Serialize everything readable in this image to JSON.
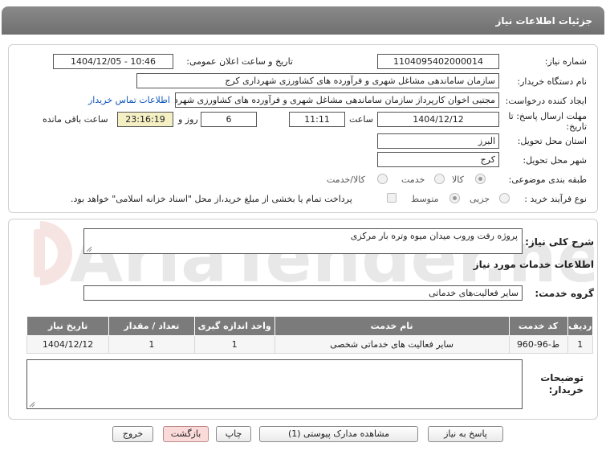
{
  "header": {
    "title": "جزئیات اطلاعات نیاز"
  },
  "form": {
    "need_number_label": "شماره نیاز:",
    "need_number": "1104095402000014",
    "announce_label": "تاریخ و ساعت اعلان عمومی:",
    "announce_value": "1404/12/05 - 10:46",
    "buyer_org_label": "نام دستگاه خریدار:",
    "buyer_org": "سازمان ساماندهی مشاغل شهری و فرآورده های کشاورزی شهرداری کرج",
    "creator_label": "ایجاد کننده درخواست:",
    "creator": "مجتبی اخوان کارپرداز سازمان ساماندهی مشاغل شهری و فرآورده های کشاورزی شهرداری کرج",
    "contact_link": "اطلاعات تماس خریدار",
    "deadline_label_1": "مهلت ارسال پاسخ: تا",
    "deadline_label_2": "تاریخ:",
    "deadline_date": "1404/12/12",
    "time_label": "ساعت",
    "deadline_time": "11:11",
    "days_value": "6",
    "days_label": "روز و",
    "remaining_time": "23:16:19",
    "remaining_label": "ساعت باقی مانده",
    "province_label": "استان محل تحویل:",
    "province": "البرز",
    "city_label": "شهر محل تحویل:",
    "city": "کرج",
    "category_label": "طبقه بندی موضوعی:",
    "category_options": [
      "کالا",
      "خدمت",
      "کالا/خدمت"
    ],
    "process_label": "نوع فرآیند خرید :",
    "process_options": [
      "جزیی",
      "متوسط"
    ],
    "payment_note": "پرداخت تمام یا بخشی از مبلغ خرید،از محل \"اسناد خزانه اسلامی\" خواهد بود."
  },
  "details": {
    "general_desc_label": "شرح کلی نیاز:",
    "general_desc": "پروژه رفت وروب میدان میوه وتره بار مرکزی",
    "services_info_title": "اطلاعات خدمات مورد نیاز",
    "service_group_label": "گروه خدمت:",
    "service_group": "سایر فعالیت‌های خدماتی",
    "buyer_notes_label_1": "توضیحات",
    "buyer_notes_label_2": "خریدار:"
  },
  "table": {
    "headers": [
      "ردیف",
      "کد خدمت",
      "نام خدمت",
      "واحد اندازه گیری",
      "تعداد / مقدار",
      "تاریخ نیاز"
    ],
    "rows": [
      [
        "1",
        "ط-96-960",
        "سایر فعالیت های خدماتی شخصی",
        "1",
        "1",
        "1404/12/12"
      ]
    ]
  },
  "buttons": {
    "reply": "پاسخ به نیاز",
    "attachments": "مشاهده مدارک پیوستی (1)",
    "print": "چاپ",
    "back": "بازگشت",
    "exit": "خروج"
  },
  "watermark": {
    "text": "AriaTender.net"
  },
  "colors": {
    "header": "#7b7b7b",
    "link": "#1155bb",
    "remaining_bg": "#f4f0c4",
    "back_btn": "#fbdada"
  }
}
